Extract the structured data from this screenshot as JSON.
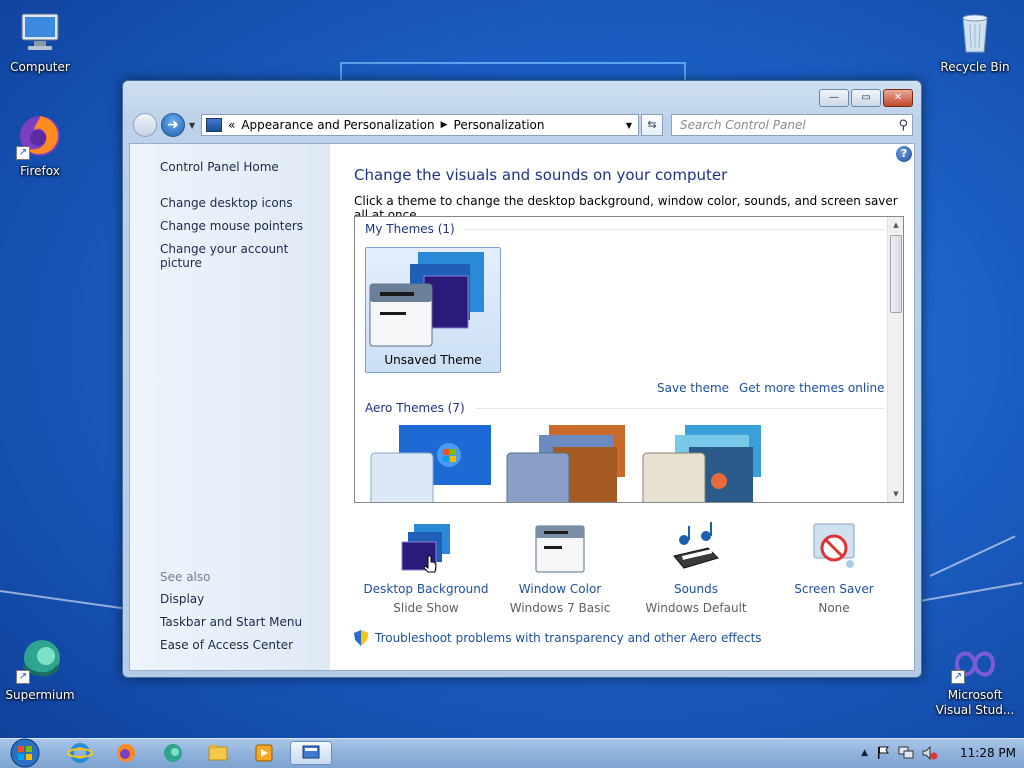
{
  "desktop": {
    "icons": {
      "computer": "Computer",
      "firefox": "Firefox",
      "recycle_bin": "Recycle Bin",
      "supermium": "Supermium",
      "visual_studio": "Microsoft Visual Stud..."
    }
  },
  "window": {
    "buttons": {
      "minimize": "—",
      "maximize": "▭",
      "close": "✕"
    },
    "address": {
      "overflow": "«",
      "crumbs": [
        "Appearance and Personalization",
        "Personalization"
      ]
    },
    "search": {
      "placeholder": "Search Control Panel"
    },
    "left_pane": {
      "home": "Control Panel Home",
      "links": [
        "Change desktop icons",
        "Change mouse pointers",
        "Change your account picture"
      ],
      "see_also_header": "See also",
      "see_also": [
        "Display",
        "Taskbar and Start Menu",
        "Ease of Access Center"
      ]
    },
    "main": {
      "title": "Change the visuals and sounds on your computer",
      "description": "Click a theme to change the desktop background, window color, sounds, and screen saver all at once.",
      "my_themes_header": "My Themes (1)",
      "selected_theme": "Unsaved Theme",
      "save_theme": "Save theme",
      "get_more": "Get more themes online",
      "aero_themes_header": "Aero Themes (7)",
      "settings": [
        {
          "title": "Desktop Background",
          "value": "Slide Show"
        },
        {
          "title": "Window Color",
          "value": "Windows 7 Basic"
        },
        {
          "title": "Sounds",
          "value": "Windows Default"
        },
        {
          "title": "Screen Saver",
          "value": "None"
        }
      ],
      "troubleshoot": "Troubleshoot problems with transparency and other Aero effects"
    }
  },
  "taskbar": {
    "clock": "11:28 PM"
  },
  "colors": {
    "link": "#1e50a2",
    "title": "#1e3287",
    "desktop": "#1b5fc4"
  }
}
